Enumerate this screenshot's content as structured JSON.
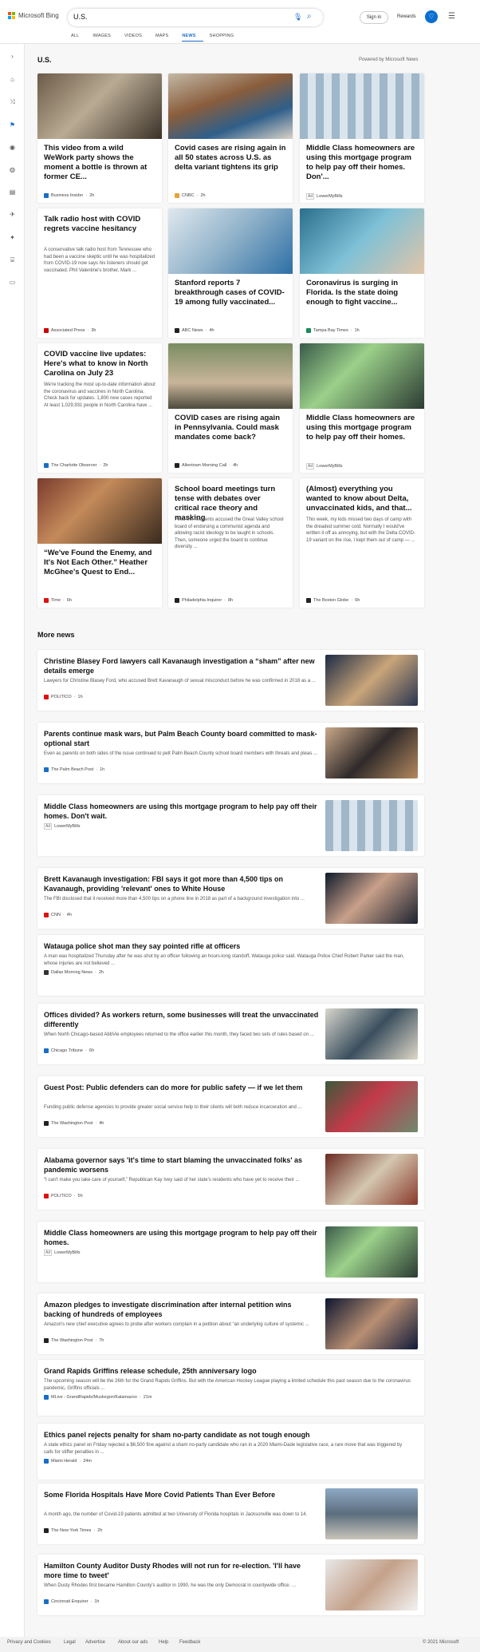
{
  "header": {
    "brand": "Microsoft Bing",
    "query": "U.S.",
    "signin": "Sign in",
    "rewards": "Rewards",
    "tabs": [
      "ALL",
      "IMAGES",
      "VIDEOS",
      "MAPS",
      "NEWS",
      "SHOPPING"
    ],
    "active_tab": "NEWS"
  },
  "section": {
    "title": "U.S.",
    "powered": "Powered by Microsoft News"
  },
  "cards": [
    {
      "title": "This video from a wild WeWork party shows the moment a bottle is thrown at former CE...",
      "desc": "",
      "source": "Business Insider",
      "time": "2h",
      "color": "#1a6ec6",
      "ad": ""
    },
    {
      "title": "Covid cases are rising again in all 50 states across U.S. as delta variant tightens its grip",
      "desc": "",
      "source": "CNBC",
      "time": "2h",
      "color": "#e8a23a",
      "ad": ""
    },
    {
      "title": "Middle Class homeowners are using this mortgage program to help pay off their homes. Don'...",
      "desc": "",
      "source": "LowerMyBills",
      "time": "",
      "color": "#888",
      "ad": "Ad"
    },
    {
      "title": "Talk radio host with COVID regrets vaccine hesitancy",
      "desc": "A conservative talk radio host from Tennessee who had been a vaccine skeptic until he was hospitalized from COVID-19 now says his listeners should get vaccinated. Phil Valentine's brother, Mark ...",
      "source": "Associated Press",
      "time": "3h",
      "color": "#c00",
      "ad": ""
    },
    {
      "title": "Stanford reports 7 breakthrough cases of COVID-19 among fully vaccinated...",
      "desc": "",
      "source": "ABC News",
      "time": "4h",
      "color": "#222",
      "ad": ""
    },
    {
      "title": "Coronavirus is surging in Florida. Is the state doing enough to fight vaccine...",
      "desc": "",
      "source": "Tampa Bay Times",
      "time": "1h",
      "color": "#1a8a5a",
      "ad": ""
    },
    {
      "title": "COVID vaccine live updates: Here's what to know in North Carolina on July 23",
      "desc": "We're tracking the most up-to-date information about the coronavirus and vaccines in North Carolina. Check back for updates. 1,800 new cases reported At least 1,029,931 people in North Carolina have ...",
      "source": "The Charlotte Observer",
      "time": "2h",
      "color": "#1a6ec6",
      "ad": ""
    },
    {
      "title": "COVID cases are rising again in Pennsylvania. Could mask mandates come back?",
      "desc": "",
      "source": "Allentown Morning Call",
      "time": "4h",
      "color": "#222",
      "ad": ""
    },
    {
      "title": "Middle Class homeowners are using this mortgage program to help pay off their homes.",
      "desc": "",
      "source": "LowerMyBills",
      "time": "",
      "color": "#888",
      "ad": "Ad"
    },
    {
      "title": "“We've Found the Enemy, and It's Not Each Other.” Heather McGhee's Quest to End...",
      "desc": "",
      "source": "Time",
      "time": "6h",
      "color": "#d11",
      "ad": ""
    },
    {
      "title": "School board meetings turn tense with debates over critical race theory and masking",
      "desc": "First, the residents accused the Great Valley school board of endorsing a communist agenda and allowing racist ideology to be taught in schools. Then, someone urged the board to continue diversity ...",
      "source": "Philadelphia Inquirer",
      "time": "8h",
      "color": "#222",
      "ad": ""
    },
    {
      "title": "(Almost) everything you wanted to know about Delta, unvaccinated kids, and that...",
      "desc": "This week, my kids missed two days of camp with the dreaded summer cold. Normally I would've written it off as annoying, but with the Delta COVID-19 variant on the rise, I kept them out of camp — ...",
      "source": "The Boston Globe",
      "time": "6h",
      "color": "#222",
      "ad": ""
    }
  ],
  "more_title": "More news",
  "rows": [
    {
      "title": "Christine Blasey Ford lawyers call Kavanaugh investigation a “sham” after new details emerge",
      "desc": "Lawyers for Christine Blasey Ford, who accused Brett Kavanaugh of sexual misconduct before he was confirmed in 2018 as a ...",
      "source": "POLITICO",
      "time": "1h",
      "color": "#d11",
      "ad": ""
    },
    {
      "title": "Parents continue mask wars, but Palm Beach County board committed to mask-optional start",
      "desc": "Even as parents on both sides of the issue continued to pelt Palm Beach County school board members with threats and pleas ...",
      "source": "The Palm Beach Post",
      "time": "1h",
      "color": "#1a6ec6",
      "ad": ""
    },
    {
      "title": "Middle Class homeowners are using this mortgage program to help pay off their homes. Don't wait.",
      "desc": "",
      "source": "LowerMyBills",
      "time": "",
      "color": "#888",
      "ad": "Ad"
    },
    {
      "title": "Brett Kavanaugh investigation: FBI says it got more than 4,500 tips on Kavanaugh, providing 'relevant' ones to White House",
      "desc": "The FBI disclosed that it received more than 4,500 tips on a phone line in 2018 as part of a background investigation into ...",
      "source": "CNN",
      "time": "4h",
      "color": "#d11",
      "ad": ""
    },
    {
      "title": "Watauga police shot man they say pointed rifle at officers",
      "desc": "A man was hospitalized Thursday after he was shot by an officer following an hours-long standoff, Watauga police said. Watauga Police Chief Robert Parker said the man, whose injuries are not believed ...",
      "source": "Dallas Morning News",
      "time": "2h",
      "color": "#333",
      "ad": ""
    },
    {
      "title": "Offices divided? As workers return, some businesses will treat the unvaccinated differently",
      "desc": "When North Chicago-based AbbVie employees returned to the office earlier this month, they faced two sets of rules based on ...",
      "source": "Chicago Tribune",
      "time": "6h",
      "color": "#1a6ec6",
      "ad": ""
    },
    {
      "title": "Guest Post: Public defenders can do more for public safety — if we let them",
      "desc": "Funding public defense agencies to provide greater social service help to their clients will both reduce incarceration and ...",
      "source": "The Washington Post",
      "time": "4h",
      "color": "#222",
      "ad": ""
    },
    {
      "title": "Alabama governor says 'it's time to start blaming the unvaccinated folks' as pandemic worsens",
      "desc": "“I can't make you take care of yourself,” Republican Kay Ivey said of her state's residents who have yet to receive their ...",
      "source": "POLITICO",
      "time": "5h",
      "color": "#d11",
      "ad": ""
    },
    {
      "title": "Middle Class homeowners are using this mortgage program to help pay off their homes.",
      "desc": "",
      "source": "LowerMyBills",
      "time": "",
      "color": "#888",
      "ad": "Ad"
    },
    {
      "title": "Amazon pledges to investigate discrimination after internal petition wins backing of hundreds of employees",
      "desc": "Amazon's new chief executive agrees to probe after workers complain in a petition about “an underlying culture of systemic ...",
      "source": "The Washington Post",
      "time": "7h",
      "color": "#222",
      "ad": ""
    },
    {
      "title": "Grand Rapids Griffins release schedule, 25th anniversary logo",
      "desc": "The upcoming season will be the 26th for the Grand Rapids Griffins. But with the American Hockey League playing a limited schedule this past season due to the coronavirus pandemic, Griffins officials ...",
      "source": "MLive - GrandRapids/Muskegon/Kalamazoo",
      "time": "21m",
      "color": "#1a6ec6",
      "ad": ""
    },
    {
      "title": "Ethics panel rejects penalty for sham no-party candidate as not tough enough",
      "desc": "A state ethics panel on Friday rejected a $6,500 fine against a sham no-party candidate who ran in a 2020 Miami-Dade legislative race, a rare move that was triggered by calls for stiffer penalties in ...",
      "source": "Miami Herald",
      "time": "24m",
      "color": "#1a6ec6",
      "ad": ""
    },
    {
      "title": "Some Florida Hospitals Have More Covid Patients Than Ever Before",
      "desc": "A month ago, the number of Covid-19 patients admitted at two University of Florida hospitals in Jacksonville was down to 14.",
      "source": "The New York Times",
      "time": "2h",
      "color": "#222",
      "ad": ""
    },
    {
      "title": "Hamilton County Auditor Dusty Rhodes will not run for re-election. 'I'll have more time to tweet'",
      "desc": "When Dusty Rhodes first became Hamilton County's auditor in 1990, he was the only Democrat in countywide office. ...",
      "source": "Cincinnati Enquirer",
      "time": "1h",
      "color": "#1a6ec6",
      "ad": ""
    }
  ],
  "footer": {
    "links": [
      "Privacy and Cookies",
      "Legal",
      "Advertise",
      "About our ads",
      "Help",
      "Feedback"
    ],
    "copyright": "© 2021 Microsoft"
  }
}
